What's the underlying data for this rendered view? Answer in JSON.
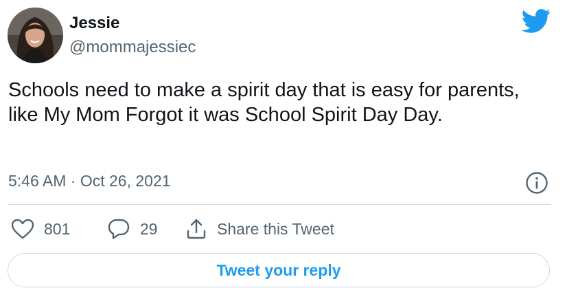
{
  "author": {
    "name": "Jessie",
    "handle": "@mommajessiec",
    "avatar": "profile-photo"
  },
  "tweet": {
    "text": "Schools need to make a spirit day that is easy for parents, like My Mom Forgot it was School Spirit Day Day.",
    "timestamp": "5:46 AM · Oct 26, 2021"
  },
  "actions": {
    "likes": "801",
    "replies": "29",
    "share_label": "Share this Tweet"
  },
  "reply_button_label": "Tweet your reply",
  "icons": {
    "brand": "twitter-bird-icon",
    "info": "info-icon",
    "like": "heart-icon",
    "reply": "speech-bubble-icon",
    "share": "share-upload-icon"
  },
  "colors": {
    "accent": "#1d9bf0",
    "text": "#0f1419",
    "secondary": "#536471",
    "border": "#cfd9de"
  }
}
